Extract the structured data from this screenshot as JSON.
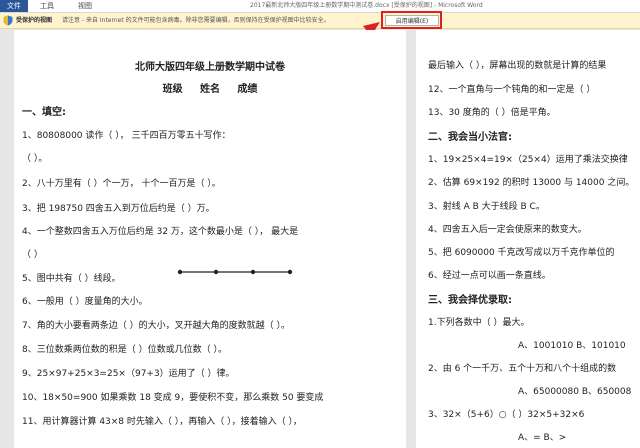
{
  "ribbon": {
    "tabs": [
      "文件",
      "工具",
      "视图"
    ],
    "window_title": "2017最新北师大版四年级上册数学期中测试卷.docx [受保护的视图] - Microsoft Word"
  },
  "protected_view": {
    "label": "受保护的视图",
    "message": "请注意 - 来自 Internet 的文件可能包含病毒。除非您需要编辑，否则保持在受保护视图中比较安全。",
    "button": "启用编辑(E)"
  },
  "left_page": {
    "title": "北师大版四年级上册数学期中试卷",
    "subtitle": "班级     姓名     成绩",
    "lines": [
      "一、填空:",
      "1、80808000 读作（                ），  三千四百万零五十写作：",
      "（           ）。",
      "2、八十万里有（  ）个一万， 十个一百万是（   ）。",
      "3、把 198750 四舍五入到万位后约是（   ）万。",
      "4、一个整数四舍五入万位后约是 32 万，这个数最小是（       ）， 最大是",
      "（            ）",
      "5、图中共有（  ）线段。",
      "6、一般用（    ）度量角的大小。",
      "7、角的大小要看两条边（    ）的大小，叉开越大角的度数就越（   ）。",
      "8、三位数乘两位数的积是（    ）位数或几位数（    ）。",
      "9、25×97+25×3=25×（97+3）运用了（       ）律。",
      "10、18×50=900 如果乘数 18 变成 9，要使积不变，那么乘数 50 要变成",
      "11、用计算器计算 43×8 时先输入（   ），再输入（   ），接着输入（   ），"
    ]
  },
  "right_page": {
    "lines": [
      "最后输入（       ），屏幕出现的数就是计算的结果",
      "12、一个直角与一个钝角的和一定是（     ）",
      "13、30 度角的（    ）倍是平角。",
      "二、我会当小法官:",
      "1、19×25×4=19×（25×4）运用了乘法交换律",
      "2、估算 69×192 的积时 13000 与 14000 之间。",
      "3、射线 A B 大于线段 B C。",
      "4、四舍五入后一定会使原来的数变大。",
      "5、把 6090000 千克改写成以万千克作单位的",
      "6、经过一点可以画一条直线。",
      "三、我会择优录取:",
      "1.下列各数中（          ）最大。",
      "A、1001010      B、101010",
      "2、由 6 个一千万、五个十万和八个十组成的数",
      "A、65000080      B、650008",
      "3、32×（5+6）○（     ）32×5+32×6",
      "A、=      B、>"
    ]
  }
}
